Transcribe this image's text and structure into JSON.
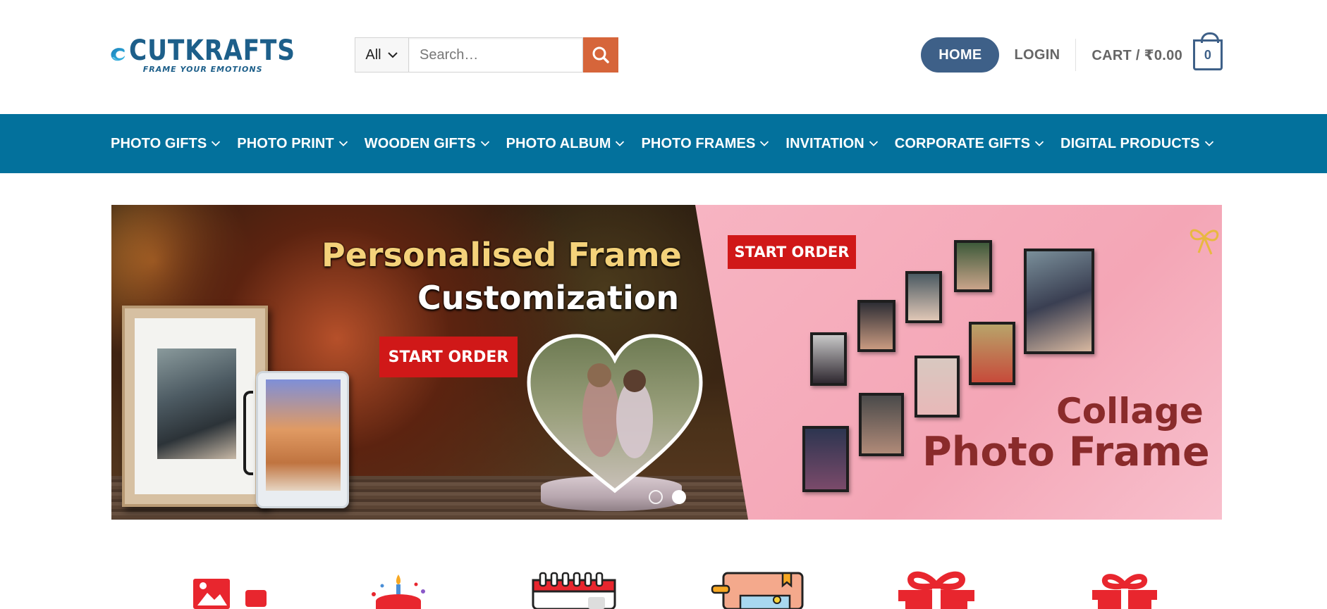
{
  "header": {
    "logo": {
      "name": "CUTKRAFTS",
      "tagline": "FRAME YOUR EMOTIONS"
    },
    "search": {
      "category": "All",
      "placeholder": "Search…"
    },
    "nav": {
      "home": "HOME",
      "login": "LOGIN",
      "cart": "CART / ₹0.00",
      "cart_count": "0"
    },
    "colors": {
      "accent": "#3e6088",
      "search_button": "#d6653a",
      "catbar": "#03719c"
    }
  },
  "categories": [
    {
      "label": "PHOTO GIFTS"
    },
    {
      "label": "PHOTO PRINT"
    },
    {
      "label": "WOODEN GIFTS"
    },
    {
      "label": "PHOTO ALBUM"
    },
    {
      "label": "PHOTO FRAMES"
    },
    {
      "label": "INVITATION"
    },
    {
      "label": "CORPORATE GIFTS"
    },
    {
      "label": "DIGITAL PRODUCTS"
    }
  ],
  "slider": {
    "left": {
      "title_line1": "Personalised Frame",
      "title_line2": "Customization",
      "button": "START ORDER"
    },
    "right": {
      "button": "START ORDER",
      "title_line1": "Collage",
      "title_line2": "Photo Frame"
    },
    "dots_count": 2,
    "active_dot": 2
  },
  "category_icons": [
    "photo-print-icon",
    "birthday-cake-icon",
    "calendar-icon",
    "photo-album-icon",
    "gift-icon",
    "gift-box-icon"
  ]
}
